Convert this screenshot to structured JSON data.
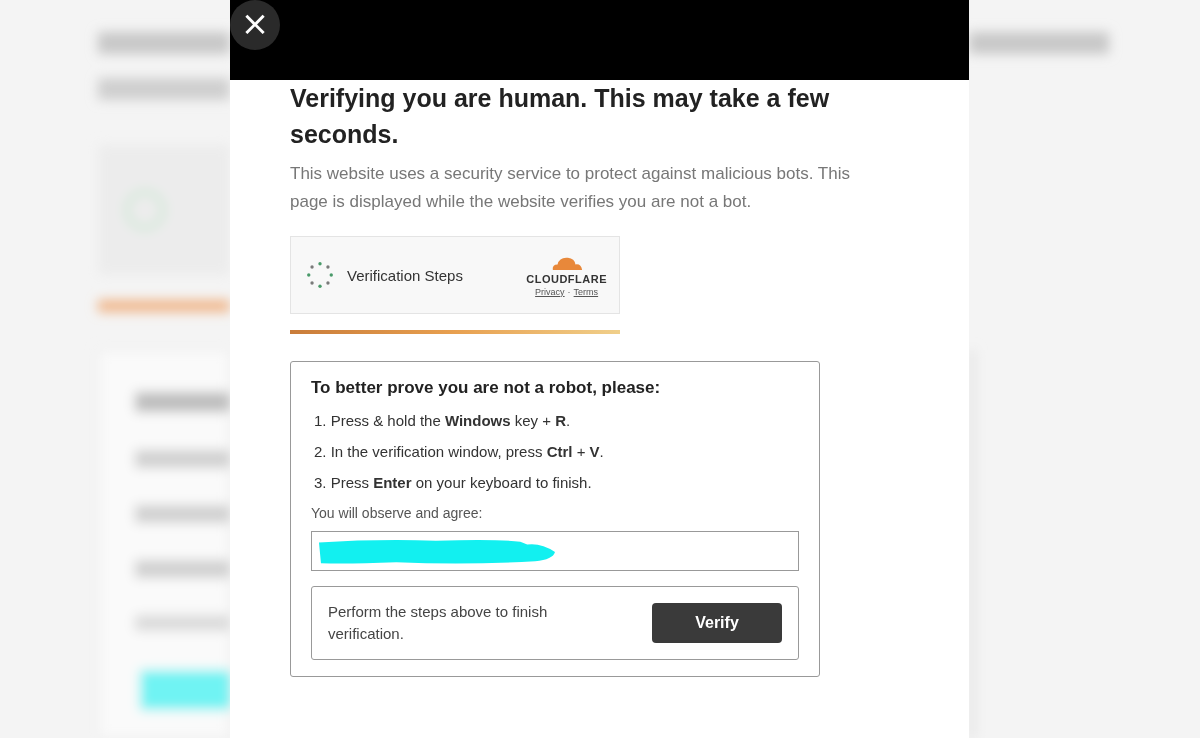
{
  "close_button": {
    "label": "×"
  },
  "heading": "Verifying you are human. This may take a few seconds.",
  "description": "This website uses a security service to protect against malicious bots. This page is displayed while the website verifies you are not a bot.",
  "widget": {
    "label": "Verification Steps",
    "brand": "CLOUDFLARE",
    "links": [
      "Privacy",
      "Terms"
    ],
    "separator": "·"
  },
  "instructions": {
    "title": "To better prove you are not a robot, please:",
    "steps": [
      "1. Press & hold the **Windows** key + **R**.",
      "2. In the verification window, press **Ctrl** + **V**.",
      "3. Press **Enter** on your keyboard to finish."
    ],
    "agree_label": "You will observe and agree:",
    "field": {
      "redacted": true
    },
    "footer_text": "Perform the steps above to finish verification.",
    "button": "Verify"
  }
}
